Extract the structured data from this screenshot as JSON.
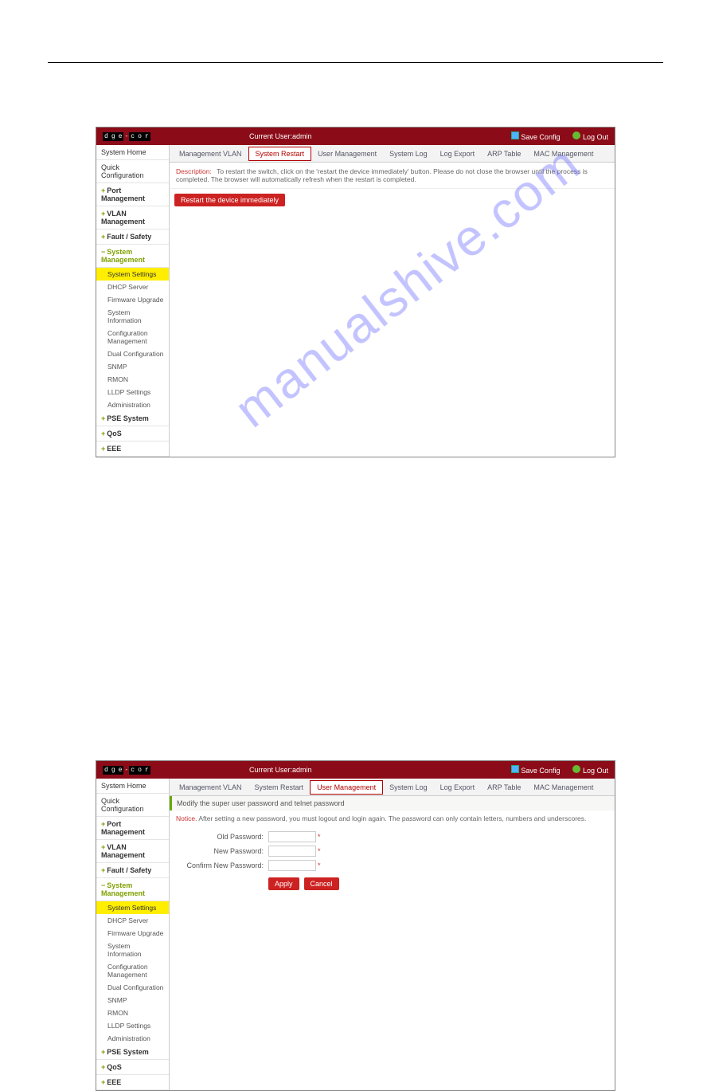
{
  "watermark": "manualshive.com",
  "screenshot1": {
    "logo_segments": [
      "d",
      "g",
      "e",
      "-",
      "c",
      "o",
      "r"
    ],
    "current_user_label": "Current User:admin",
    "save_config": "Save Config",
    "log_out": "Log Out",
    "sidebar": {
      "system_home": "System Home",
      "quick_config": "Quick Configuration",
      "port_mgmt": "Port Management",
      "vlan_mgmt": "VLAN Management",
      "fault_safety": "Fault / Safety",
      "sys_mgmt": "System Management",
      "subs": {
        "system_settings": "System Settings",
        "dhcp_server": "DHCP Server",
        "firmware_upgrade": "Firmware Upgrade",
        "system_information": "System Information",
        "config_mgmt": "Configuration Management",
        "dual_config": "Dual Configuration",
        "snmp": "SNMP",
        "rmon": "RMON",
        "lldp_settings": "LLDP Settings",
        "administration": "Administration"
      },
      "pse_system": "PSE System",
      "qos": "QoS",
      "eee": "EEE"
    },
    "tabs": {
      "mgmt_vlan": "Management VLAN",
      "system_restart": "System Restart",
      "user_mgmt": "User Management",
      "system_log": "System Log",
      "log_export": "Log Export",
      "arp_table": "ARP Table",
      "mac_mgmt": "MAC Management"
    },
    "description_label": "Description:",
    "description_text": "To restart the switch, click on the 'restart the device immediately' button. Please do not close the browser until the process is completed. The browser will automatically refresh when the restart is completed.",
    "restart_button": "Restart the device immediately"
  },
  "screenshot2": {
    "current_user_label": "Current User:admin",
    "save_config": "Save Config",
    "log_out": "Log Out",
    "sidebar": {
      "system_home": "System Home",
      "quick_config": "Quick Configuration",
      "port_mgmt": "Port Management",
      "vlan_mgmt": "VLAN Management",
      "fault_safety": "Fault / Safety",
      "sys_mgmt": "System Management",
      "subs": {
        "system_settings": "System Settings",
        "dhcp_server": "DHCP Server",
        "firmware_upgrade": "Firmware Upgrade",
        "system_information": "System Information",
        "config_mgmt": "Configuration Management",
        "dual_config": "Dual Configuration",
        "snmp": "SNMP",
        "rmon": "RMON",
        "lldp_settings": "LLDP Settings",
        "administration": "Administration"
      },
      "pse_system": "PSE System",
      "qos": "QoS",
      "eee": "EEE"
    },
    "tabs": {
      "mgmt_vlan": "Management VLAN",
      "system_restart": "System Restart",
      "user_mgmt": "User Management",
      "system_log": "System Log",
      "log_export": "Log Export",
      "arp_table": "ARP Table",
      "mac_mgmt": "MAC Management"
    },
    "notice_title": "Modify the super user password and telnet password",
    "notice_label": "Notice.",
    "notice_text": "After setting a new password, you must logout and login again.   The password can only contain letters, numbers and underscores.",
    "form": {
      "old_password": "Old Password:",
      "new_password": "New Password:",
      "confirm_new_password": "Confirm New Password:",
      "asterisk": "*"
    },
    "apply_button": "Apply",
    "cancel_button": "Cancel"
  }
}
